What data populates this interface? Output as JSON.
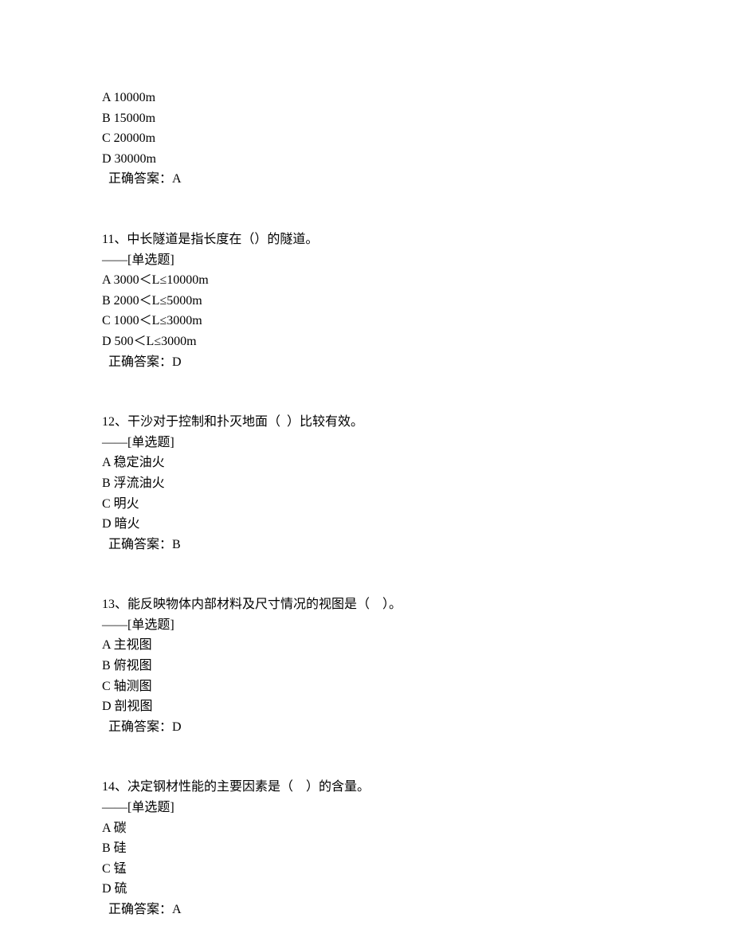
{
  "blocks": [
    {
      "lines": [
        "A 10000m",
        "B 15000m",
        "C 20000m",
        "D 30000m"
      ],
      "answer": "正确答案：A"
    },
    {
      "lines": [
        "11、中长隧道是指长度在（）的隧道。",
        "——[单选题]",
        "A 3000＜L≤10000m",
        "B 2000＜L≤5000m",
        "C 1000＜L≤3000m",
        "D 500＜L≤3000m"
      ],
      "answer": "正确答案：D"
    },
    {
      "lines": [
        "12、干沙对于控制和扑灭地面（  ）比较有效。",
        "——[单选题]",
        "A 稳定油火",
        "B 浮流油火",
        "C 明火",
        "D 暗火"
      ],
      "answer": "正确答案：B"
    },
    {
      "lines": [
        "13、能反映物体内部材料及尺寸情况的视图是（    ）。",
        "——[单选题]",
        "A 主视图",
        "B 俯视图",
        "C 轴测图",
        "D 剖视图"
      ],
      "answer": "正确答案：D"
    },
    {
      "lines": [
        "14、决定钢材性能的主要因素是（    ）的含量。",
        "——[单选题]",
        "A 碳",
        "B 硅",
        "C 锰",
        "D 硫"
      ],
      "answer": "正确答案：A"
    }
  ]
}
